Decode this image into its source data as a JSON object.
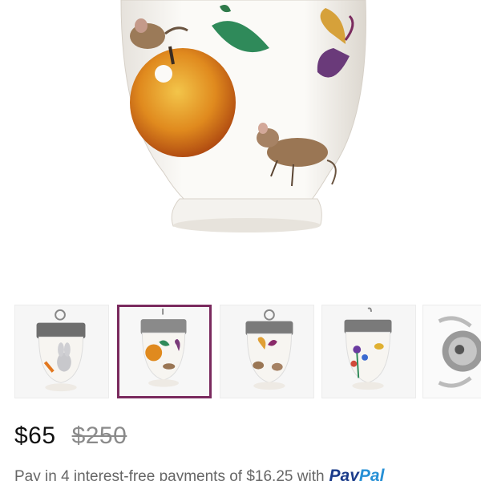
{
  "product": {
    "hero_image": {
      "alt": "Porcelain egg coddler painted with mice, apple, leaf and butterfly"
    },
    "thumbnails": [
      {
        "motif": "rabbit with carrot",
        "selected": false
      },
      {
        "motif": "apple, mice and butterfly",
        "selected": true
      },
      {
        "motif": "butterfly and mice",
        "selected": false
      },
      {
        "motif": "flowers and bee",
        "selected": false
      },
      {
        "motif": "lid view",
        "selected": false
      }
    ],
    "price": "$65",
    "original_price": "$250",
    "installment_text": "Pay in 4 interest-free payments of $16.25 with",
    "paypal_part1": "Pay",
    "paypal_part2": "Pal"
  },
  "colors": {
    "selected_border": "#7a2a5e",
    "paypal_dark": "#1a3b8a",
    "paypal_light": "#2790d6"
  }
}
